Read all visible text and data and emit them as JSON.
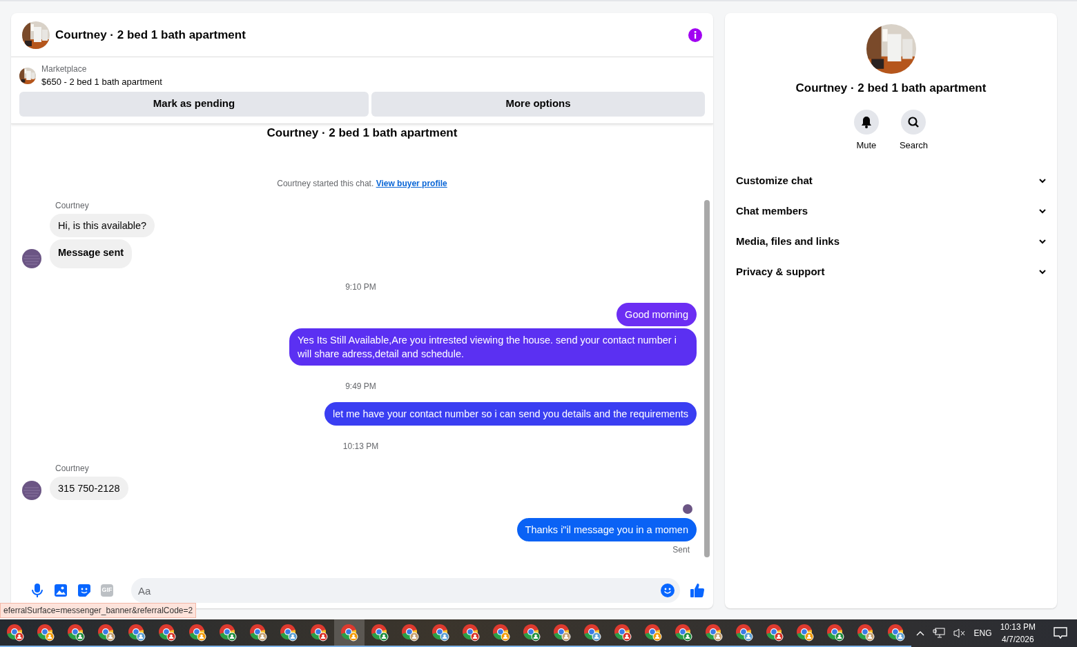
{
  "chat": {
    "title": "Courtney · 2 bed 1 bath apartment",
    "listing": {
      "source": "Marketplace",
      "summary": "$650 - 2 bed 1 bath apartment"
    },
    "listing_buttons": [
      "Mark as pending",
      "More options"
    ],
    "clipped_title": "Courtney · 2 bed 1 bath apartment",
    "intro": {
      "text": "Courtney started this chat.",
      "link": "View buyer profile"
    },
    "items": [
      {
        "kind": "incoming",
        "sender": "Courtney",
        "bubbles": [
          {
            "text": "Hi, is this available?",
            "bold": false
          },
          {
            "text": "Message sent",
            "bold": true
          }
        ]
      },
      {
        "kind": "time",
        "text": "9:10 PM"
      },
      {
        "kind": "outgoing",
        "bubbles": [
          {
            "text": "Good morning",
            "color": "#6c2ef3"
          },
          {
            "text": "Yes Its Still Available,Are you intrested viewing the house. send your contact number i will share adress,detail and schedule.",
            "color": "#5b30f2"
          }
        ]
      },
      {
        "kind": "time",
        "text": "9:49 PM"
      },
      {
        "kind": "outgoing",
        "bubbles": [
          {
            "text": "let me have your contact number so i can send you details and the requirements",
            "color": "#3a3ef2"
          }
        ]
      },
      {
        "kind": "time",
        "text": "10:13 PM"
      },
      {
        "kind": "incoming",
        "sender": "Courtney",
        "bubbles": [
          {
            "text": "315 750-2128",
            "bold": false
          }
        ]
      },
      {
        "kind": "seen"
      },
      {
        "kind": "outgoing",
        "bubbles": [
          {
            "text": "Thanks i\"il message you in a momen",
            "color": "#0a62f5"
          }
        ],
        "status": "Sent"
      }
    ],
    "composer": {
      "placeholder": "Aa",
      "gif_label": "GIF"
    }
  },
  "details": {
    "title": "Courtney · 2 bed 1 bath apartment",
    "actions": [
      {
        "kind": "mute",
        "label": "Mute"
      },
      {
        "kind": "search",
        "label": "Search"
      }
    ],
    "sections": [
      {
        "label": "Customize chat",
        "expanded": false
      },
      {
        "label": "Chat members",
        "expanded": false
      },
      {
        "label": "Media, files and links",
        "expanded": false
      },
      {
        "label": "Privacy & support",
        "expanded": false
      }
    ]
  },
  "status_url": "eferralSurface=messenger_banner&referralCode=2",
  "taskbar": {
    "apps": [
      {
        "selected": false
      },
      {
        "selected": false
      },
      {
        "selected": false
      },
      {
        "selected": false
      },
      {
        "selected": false
      },
      {
        "selected": false
      },
      {
        "selected": false
      },
      {
        "selected": false
      },
      {
        "selected": false
      },
      {
        "selected": false
      },
      {
        "selected": false
      },
      {
        "selected": true
      },
      {
        "selected": false
      },
      {
        "selected": false
      },
      {
        "selected": false
      },
      {
        "selected": false
      },
      {
        "selected": false
      },
      {
        "selected": false
      },
      {
        "selected": false
      },
      {
        "selected": false
      },
      {
        "selected": false
      },
      {
        "selected": false
      },
      {
        "selected": false
      },
      {
        "selected": false
      },
      {
        "selected": false
      },
      {
        "selected": false
      },
      {
        "selected": false
      },
      {
        "selected": false
      },
      {
        "selected": false
      },
      {
        "selected": false
      }
    ],
    "language": "ENG",
    "time": "10:13 PM",
    "date": "4/7/2026"
  }
}
